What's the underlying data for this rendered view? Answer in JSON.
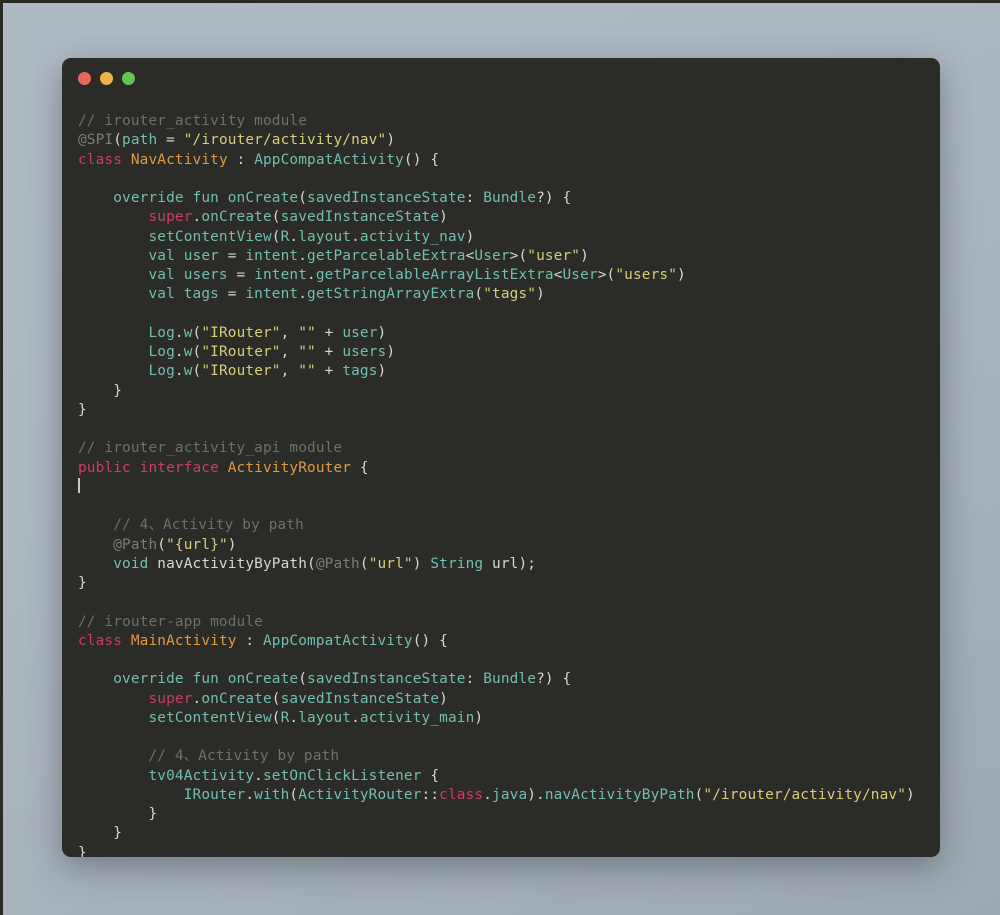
{
  "window": {
    "controls": [
      {
        "name": "close",
        "color": "#e8685c"
      },
      {
        "name": "minimize",
        "color": "#eab44a"
      },
      {
        "name": "maximize",
        "color": "#62c554"
      }
    ],
    "background": "#2b2b27",
    "desktop_background": "#aab4be"
  },
  "editor": {
    "language": "kotlin-java",
    "caret_visible": true,
    "theme": {
      "comment": "#6f7069",
      "annotation": "#7b7c75",
      "keyword": "#cb3e63",
      "type": "#e39846",
      "teal": "#71bfb0",
      "string": "#d6cf7a",
      "plain": "#d8d8d2"
    },
    "lines": [
      {
        "tokens": [
          {
            "t": "// irouter_activity module",
            "c": "cmt"
          }
        ]
      },
      {
        "tokens": [
          {
            "t": "@SPI",
            "c": "anno"
          },
          {
            "t": "(",
            "c": "punct"
          },
          {
            "t": "path",
            "c": "teal"
          },
          {
            "t": " = ",
            "c": "plain"
          },
          {
            "t": "\"/irouter/activity/nav\"",
            "c": "str"
          },
          {
            "t": ")",
            "c": "punct"
          }
        ]
      },
      {
        "tokens": [
          {
            "t": "class",
            "c": "kw"
          },
          {
            "t": " ",
            "c": "plain"
          },
          {
            "t": "NavActivity",
            "c": "type"
          },
          {
            "t": " : ",
            "c": "plain"
          },
          {
            "t": "AppCompatActivity",
            "c": "teal"
          },
          {
            "t": "() {",
            "c": "plain"
          }
        ]
      },
      {
        "tokens": []
      },
      {
        "tokens": [
          {
            "t": "    ",
            "c": "plain"
          },
          {
            "t": "override fun",
            "c": "teal"
          },
          {
            "t": " ",
            "c": "plain"
          },
          {
            "t": "onCreate",
            "c": "teal"
          },
          {
            "t": "(",
            "c": "plain"
          },
          {
            "t": "savedInstanceState",
            "c": "teal"
          },
          {
            "t": ": ",
            "c": "plain"
          },
          {
            "t": "Bundle",
            "c": "teal"
          },
          {
            "t": "?) {",
            "c": "plain"
          }
        ]
      },
      {
        "tokens": [
          {
            "t": "        ",
            "c": "plain"
          },
          {
            "t": "super",
            "c": "kw"
          },
          {
            "t": ".",
            "c": "plain"
          },
          {
            "t": "onCreate",
            "c": "teal"
          },
          {
            "t": "(",
            "c": "plain"
          },
          {
            "t": "savedInstanceState",
            "c": "teal"
          },
          {
            "t": ")",
            "c": "plain"
          }
        ]
      },
      {
        "tokens": [
          {
            "t": "        ",
            "c": "plain"
          },
          {
            "t": "setContentView",
            "c": "teal"
          },
          {
            "t": "(",
            "c": "plain"
          },
          {
            "t": "R",
            "c": "teal"
          },
          {
            "t": ".",
            "c": "plain"
          },
          {
            "t": "layout",
            "c": "teal"
          },
          {
            "t": ".",
            "c": "plain"
          },
          {
            "t": "activity_nav",
            "c": "teal"
          },
          {
            "t": ")",
            "c": "plain"
          }
        ]
      },
      {
        "tokens": [
          {
            "t": "        ",
            "c": "plain"
          },
          {
            "t": "val user",
            "c": "teal"
          },
          {
            "t": " = ",
            "c": "plain"
          },
          {
            "t": "intent",
            "c": "teal"
          },
          {
            "t": ".",
            "c": "plain"
          },
          {
            "t": "getParcelableExtra",
            "c": "teal"
          },
          {
            "t": "<",
            "c": "plain"
          },
          {
            "t": "User",
            "c": "teal"
          },
          {
            "t": ">(",
            "c": "plain"
          },
          {
            "t": "\"user\"",
            "c": "str"
          },
          {
            "t": ")",
            "c": "plain"
          }
        ]
      },
      {
        "tokens": [
          {
            "t": "        ",
            "c": "plain"
          },
          {
            "t": "val users",
            "c": "teal"
          },
          {
            "t": " = ",
            "c": "plain"
          },
          {
            "t": "intent",
            "c": "teal"
          },
          {
            "t": ".",
            "c": "plain"
          },
          {
            "t": "getParcelableArrayListExtra",
            "c": "teal"
          },
          {
            "t": "<",
            "c": "plain"
          },
          {
            "t": "User",
            "c": "teal"
          },
          {
            "t": ">(",
            "c": "plain"
          },
          {
            "t": "\"users\"",
            "c": "str"
          },
          {
            "t": ")",
            "c": "plain"
          }
        ]
      },
      {
        "tokens": [
          {
            "t": "        ",
            "c": "plain"
          },
          {
            "t": "val tags",
            "c": "teal"
          },
          {
            "t": " = ",
            "c": "plain"
          },
          {
            "t": "intent",
            "c": "teal"
          },
          {
            "t": ".",
            "c": "plain"
          },
          {
            "t": "getStringArrayExtra",
            "c": "teal"
          },
          {
            "t": "(",
            "c": "plain"
          },
          {
            "t": "\"tags\"",
            "c": "str"
          },
          {
            "t": ")",
            "c": "plain"
          }
        ]
      },
      {
        "tokens": []
      },
      {
        "tokens": [
          {
            "t": "        ",
            "c": "plain"
          },
          {
            "t": "Log",
            "c": "teal"
          },
          {
            "t": ".",
            "c": "plain"
          },
          {
            "t": "w",
            "c": "teal"
          },
          {
            "t": "(",
            "c": "plain"
          },
          {
            "t": "\"IRouter\"",
            "c": "str"
          },
          {
            "t": ", ",
            "c": "plain"
          },
          {
            "t": "\"\"",
            "c": "str"
          },
          {
            "t": " + ",
            "c": "plain"
          },
          {
            "t": "user",
            "c": "teal"
          },
          {
            "t": ")",
            "c": "plain"
          }
        ]
      },
      {
        "tokens": [
          {
            "t": "        ",
            "c": "plain"
          },
          {
            "t": "Log",
            "c": "teal"
          },
          {
            "t": ".",
            "c": "plain"
          },
          {
            "t": "w",
            "c": "teal"
          },
          {
            "t": "(",
            "c": "plain"
          },
          {
            "t": "\"IRouter\"",
            "c": "str"
          },
          {
            "t": ", ",
            "c": "plain"
          },
          {
            "t": "\"\"",
            "c": "str"
          },
          {
            "t": " + ",
            "c": "plain"
          },
          {
            "t": "users",
            "c": "teal"
          },
          {
            "t": ")",
            "c": "plain"
          }
        ]
      },
      {
        "tokens": [
          {
            "t": "        ",
            "c": "plain"
          },
          {
            "t": "Log",
            "c": "teal"
          },
          {
            "t": ".",
            "c": "plain"
          },
          {
            "t": "w",
            "c": "teal"
          },
          {
            "t": "(",
            "c": "plain"
          },
          {
            "t": "\"IRouter\"",
            "c": "str"
          },
          {
            "t": ", ",
            "c": "plain"
          },
          {
            "t": "\"\"",
            "c": "str"
          },
          {
            "t": " + ",
            "c": "plain"
          },
          {
            "t": "tags",
            "c": "teal"
          },
          {
            "t": ")",
            "c": "plain"
          }
        ]
      },
      {
        "tokens": [
          {
            "t": "    }",
            "c": "plain"
          }
        ]
      },
      {
        "tokens": [
          {
            "t": "}",
            "c": "plain"
          }
        ]
      },
      {
        "tokens": []
      },
      {
        "tokens": [
          {
            "t": "// irouter_activity_api module",
            "c": "cmt"
          }
        ]
      },
      {
        "tokens": [
          {
            "t": "public interface",
            "c": "kw"
          },
          {
            "t": " ",
            "c": "plain"
          },
          {
            "t": "ActivityRouter",
            "c": "type"
          },
          {
            "t": " {",
            "c": "plain"
          }
        ]
      },
      {
        "tokens": [],
        "caret": true
      },
      {
        "tokens": []
      },
      {
        "tokens": [
          {
            "t": "    ",
            "c": "plain"
          },
          {
            "t": "// 4、Activity by path",
            "c": "cmt"
          }
        ]
      },
      {
        "tokens": [
          {
            "t": "    ",
            "c": "plain"
          },
          {
            "t": "@Path",
            "c": "anno"
          },
          {
            "t": "(",
            "c": "plain"
          },
          {
            "t": "\"{url}\"",
            "c": "str"
          },
          {
            "t": ")",
            "c": "plain"
          }
        ]
      },
      {
        "tokens": [
          {
            "t": "    ",
            "c": "plain"
          },
          {
            "t": "void",
            "c": "teal"
          },
          {
            "t": " ",
            "c": "plain"
          },
          {
            "t": "navActivityByPath",
            "c": "plain"
          },
          {
            "t": "(",
            "c": "plain"
          },
          {
            "t": "@Path",
            "c": "anno"
          },
          {
            "t": "(",
            "c": "plain"
          },
          {
            "t": "\"url\"",
            "c": "str"
          },
          {
            "t": ") ",
            "c": "plain"
          },
          {
            "t": "String",
            "c": "teal"
          },
          {
            "t": " url);",
            "c": "plain"
          }
        ]
      },
      {
        "tokens": [
          {
            "t": "}",
            "c": "plain"
          }
        ]
      },
      {
        "tokens": []
      },
      {
        "tokens": [
          {
            "t": "// irouter-app module",
            "c": "cmt"
          }
        ]
      },
      {
        "tokens": [
          {
            "t": "class",
            "c": "kw"
          },
          {
            "t": " ",
            "c": "plain"
          },
          {
            "t": "MainActivity",
            "c": "type"
          },
          {
            "t": " : ",
            "c": "plain"
          },
          {
            "t": "AppCompatActivity",
            "c": "teal"
          },
          {
            "t": "() {",
            "c": "plain"
          }
        ]
      },
      {
        "tokens": []
      },
      {
        "tokens": [
          {
            "t": "    ",
            "c": "plain"
          },
          {
            "t": "override fun",
            "c": "teal"
          },
          {
            "t": " ",
            "c": "plain"
          },
          {
            "t": "onCreate",
            "c": "teal"
          },
          {
            "t": "(",
            "c": "plain"
          },
          {
            "t": "savedInstanceState",
            "c": "teal"
          },
          {
            "t": ": ",
            "c": "plain"
          },
          {
            "t": "Bundle",
            "c": "teal"
          },
          {
            "t": "?) {",
            "c": "plain"
          }
        ]
      },
      {
        "tokens": [
          {
            "t": "        ",
            "c": "plain"
          },
          {
            "t": "super",
            "c": "kw"
          },
          {
            "t": ".",
            "c": "plain"
          },
          {
            "t": "onCreate",
            "c": "teal"
          },
          {
            "t": "(",
            "c": "plain"
          },
          {
            "t": "savedInstanceState",
            "c": "teal"
          },
          {
            "t": ")",
            "c": "plain"
          }
        ]
      },
      {
        "tokens": [
          {
            "t": "        ",
            "c": "plain"
          },
          {
            "t": "setContentView",
            "c": "teal"
          },
          {
            "t": "(",
            "c": "plain"
          },
          {
            "t": "R",
            "c": "teal"
          },
          {
            "t": ".",
            "c": "plain"
          },
          {
            "t": "layout",
            "c": "teal"
          },
          {
            "t": ".",
            "c": "plain"
          },
          {
            "t": "activity_main",
            "c": "teal"
          },
          {
            "t": ")",
            "c": "plain"
          }
        ]
      },
      {
        "tokens": []
      },
      {
        "tokens": [
          {
            "t": "        ",
            "c": "plain"
          },
          {
            "t": "// 4、Activity by path",
            "c": "cmt"
          }
        ]
      },
      {
        "tokens": [
          {
            "t": "        ",
            "c": "plain"
          },
          {
            "t": "tv04Activity",
            "c": "teal"
          },
          {
            "t": ".",
            "c": "plain"
          },
          {
            "t": "setOnClickListener",
            "c": "teal"
          },
          {
            "t": " {",
            "c": "plain"
          }
        ]
      },
      {
        "tokens": [
          {
            "t": "            ",
            "c": "plain"
          },
          {
            "t": "IRouter",
            "c": "teal"
          },
          {
            "t": ".",
            "c": "plain"
          },
          {
            "t": "with",
            "c": "teal"
          },
          {
            "t": "(",
            "c": "plain"
          },
          {
            "t": "ActivityRouter",
            "c": "teal"
          },
          {
            "t": "::",
            "c": "plain"
          },
          {
            "t": "class",
            "c": "kw"
          },
          {
            "t": ".",
            "c": "plain"
          },
          {
            "t": "java",
            "c": "teal"
          },
          {
            "t": ").",
            "c": "plain"
          },
          {
            "t": "navActivityByPath",
            "c": "teal"
          },
          {
            "t": "(",
            "c": "plain"
          },
          {
            "t": "\"/irouter/activity/nav\"",
            "c": "str"
          },
          {
            "t": ")",
            "c": "plain"
          }
        ]
      },
      {
        "tokens": [
          {
            "t": "        }",
            "c": "plain"
          }
        ]
      },
      {
        "tokens": [
          {
            "t": "    }",
            "c": "plain"
          }
        ]
      },
      {
        "tokens": [
          {
            "t": "}",
            "c": "plain"
          }
        ]
      }
    ]
  }
}
